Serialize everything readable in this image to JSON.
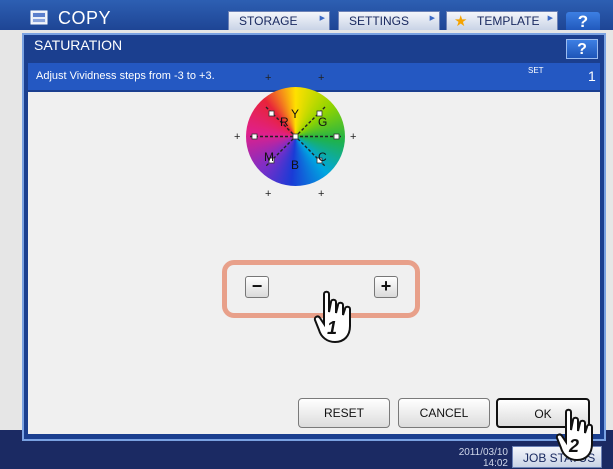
{
  "header": {
    "title": "COPY",
    "tabs": [
      {
        "label": "STORAGE"
      },
      {
        "label": "SETTINGS"
      },
      {
        "label": "TEMPLATE"
      }
    ],
    "help_label": "?"
  },
  "dialog": {
    "title": "SATURATION",
    "help_label": "?",
    "instruction": "Adjust Vividness steps from -3 to +3.",
    "set_label": "SET",
    "set_value": "1",
    "wheel_labels": {
      "r": "R",
      "y": "Y",
      "g": "G",
      "m": "M",
      "b": "B",
      "c": "C"
    },
    "minus_label": "−",
    "plus_label": "+",
    "buttons": {
      "reset": "RESET",
      "cancel": "CANCEL",
      "ok": "OK"
    },
    "callouts": {
      "step1": "1",
      "step2": "2"
    }
  },
  "footer": {
    "date": "2011/03/10",
    "time": "14:02",
    "job_status": "JOB STATUS"
  },
  "colors": {
    "title_bar": "#1e4595",
    "dialog_bar": "#2458c2",
    "highlight": "#e8a08a"
  }
}
